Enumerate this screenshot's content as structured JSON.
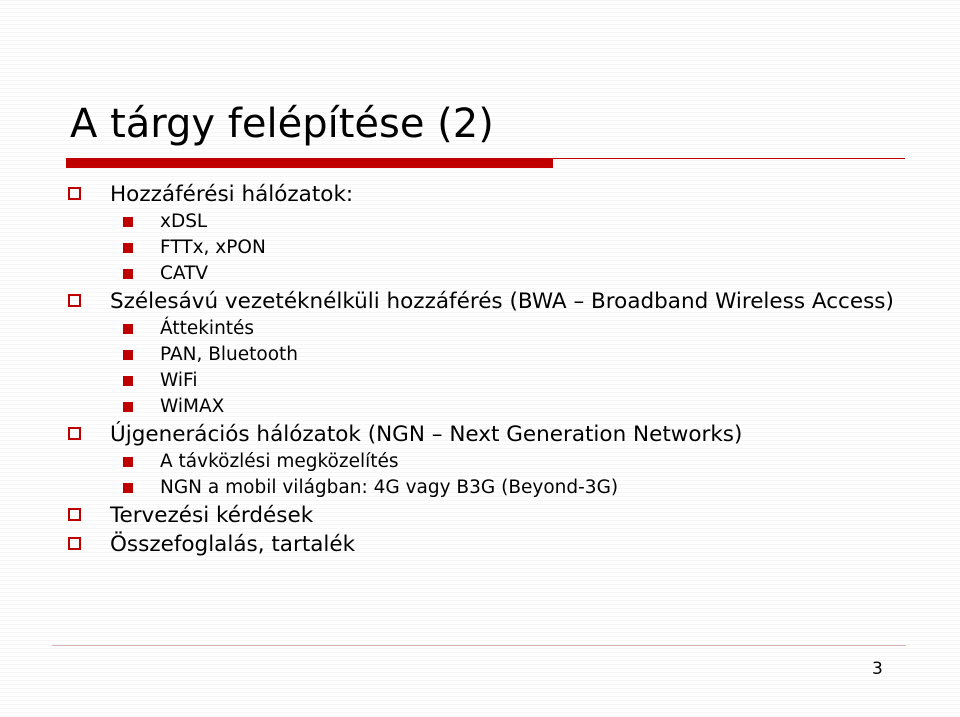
{
  "slide": {
    "title": "A tárgy felépítése (2)",
    "page_number": "3",
    "accent_color": "#c20000",
    "rule_color": "#c00000",
    "footer_rule_color": "#d9b3b3",
    "bullets": [
      {
        "level": 1,
        "text": "Hozzáférési hálózatok:"
      },
      {
        "level": 2,
        "text": "xDSL"
      },
      {
        "level": 2,
        "text": "FTTx, xPON"
      },
      {
        "level": 2,
        "text": "CATV"
      },
      {
        "level": 1,
        "text": "Szélesávú vezetéknélküli hozzáférés (BWA – Broadband Wireless Access)"
      },
      {
        "level": 2,
        "text": "Áttekintés"
      },
      {
        "level": 2,
        "text": "PAN, Bluetooth"
      },
      {
        "level": 2,
        "text": "WiFi"
      },
      {
        "level": 2,
        "text": "WiMAX"
      },
      {
        "level": 1,
        "text": "Újgenerációs hálózatok (NGN – Next Generation Networks)"
      },
      {
        "level": 2,
        "text": "A távközlési megközelítés"
      },
      {
        "level": 2,
        "text": "NGN a mobil világban: 4G vagy B3G (Beyond-3G)"
      },
      {
        "level": 1,
        "text": "Tervezési kérdések"
      },
      {
        "level": 1,
        "text": "Összefoglalás, tartalék"
      }
    ]
  }
}
